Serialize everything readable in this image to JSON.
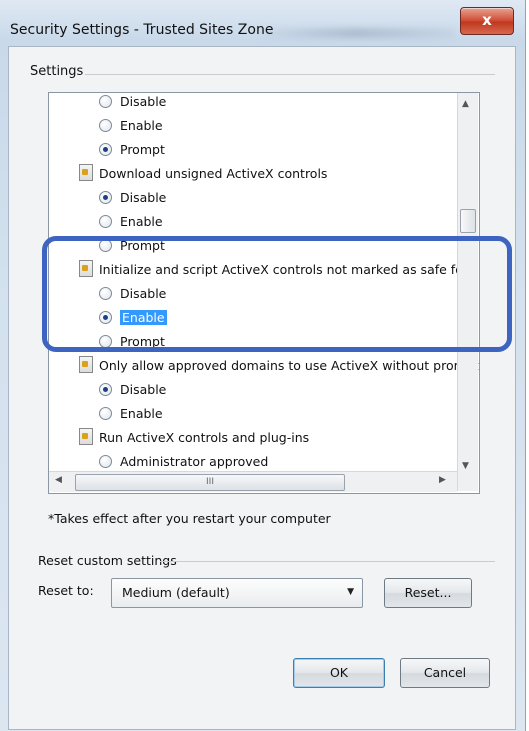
{
  "window": {
    "title": "Security Settings - Trusted Sites Zone",
    "close_label": "x"
  },
  "settings": {
    "group_label": "Settings",
    "rows": [
      {
        "kind": "option",
        "label": "Disable",
        "checked": false
      },
      {
        "kind": "option",
        "label": "Enable",
        "checked": false
      },
      {
        "kind": "option",
        "label": "Prompt",
        "checked": true
      },
      {
        "kind": "category",
        "label": "Download unsigned ActiveX controls"
      },
      {
        "kind": "option",
        "label": "Disable",
        "checked": true
      },
      {
        "kind": "option",
        "label": "Enable",
        "checked": false
      },
      {
        "kind": "option",
        "label": "Prompt",
        "checked": false
      },
      {
        "kind": "category",
        "label": "Initialize and script ActiveX controls not marked as safe for s"
      },
      {
        "kind": "option",
        "label": "Disable",
        "checked": false
      },
      {
        "kind": "option",
        "label": "Enable",
        "checked": true,
        "selected": true
      },
      {
        "kind": "option",
        "label": "Prompt",
        "checked": false
      },
      {
        "kind": "category",
        "label": "Only allow approved domains to use ActiveX without prompt"
      },
      {
        "kind": "option",
        "label": "Disable",
        "checked": true
      },
      {
        "kind": "option",
        "label": "Enable",
        "checked": false
      },
      {
        "kind": "category",
        "label": "Run ActiveX controls and plug-ins"
      },
      {
        "kind": "option",
        "label": "Administrator approved",
        "checked": false
      }
    ],
    "hscroll_grip": "III",
    "note": "*Takes effect after you restart your computer"
  },
  "reset": {
    "group_label": "Reset custom settings",
    "reset_to_label": "Reset to:",
    "selected_level": "Medium (default)",
    "reset_button": "Reset..."
  },
  "buttons": {
    "ok": "OK",
    "cancel": "Cancel"
  },
  "colors": {
    "highlight_outline": "#3c64c0",
    "selection": "#3399ff",
    "close_button": "#c0391f"
  }
}
